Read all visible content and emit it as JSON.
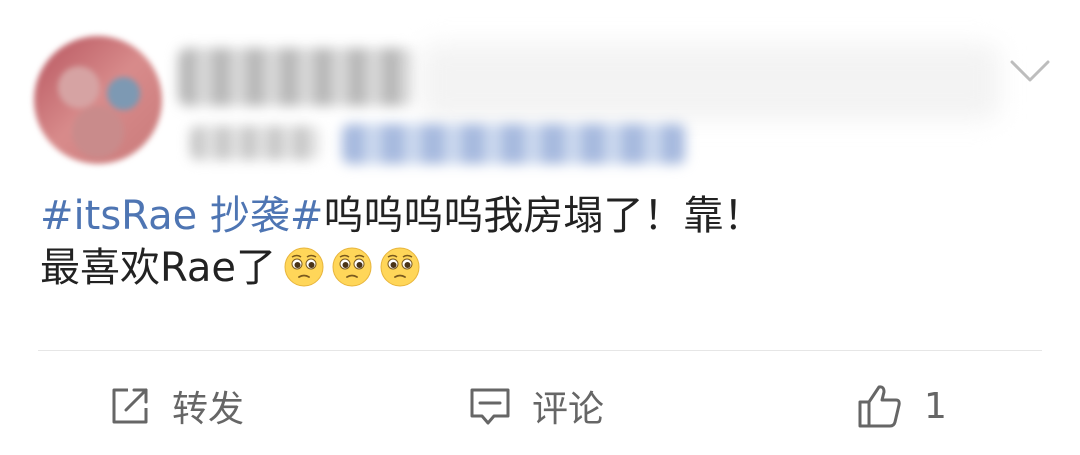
{
  "post": {
    "hashtag": "#itsRae 抄袭#",
    "text_line1": "呜呜呜呜我房塌了！靠！",
    "text_line2": "最喜欢Rae了",
    "emojis": [
      "pleading-face-icon",
      "pleading-face-icon",
      "pleading-face-icon"
    ]
  },
  "actions": {
    "repost_label": "转发",
    "comment_label": "评论",
    "like_count": "1"
  },
  "colors": {
    "hashtag": "#4e75b3",
    "text": "#222222",
    "action": "#666666",
    "divider": "#e6e6e6"
  }
}
